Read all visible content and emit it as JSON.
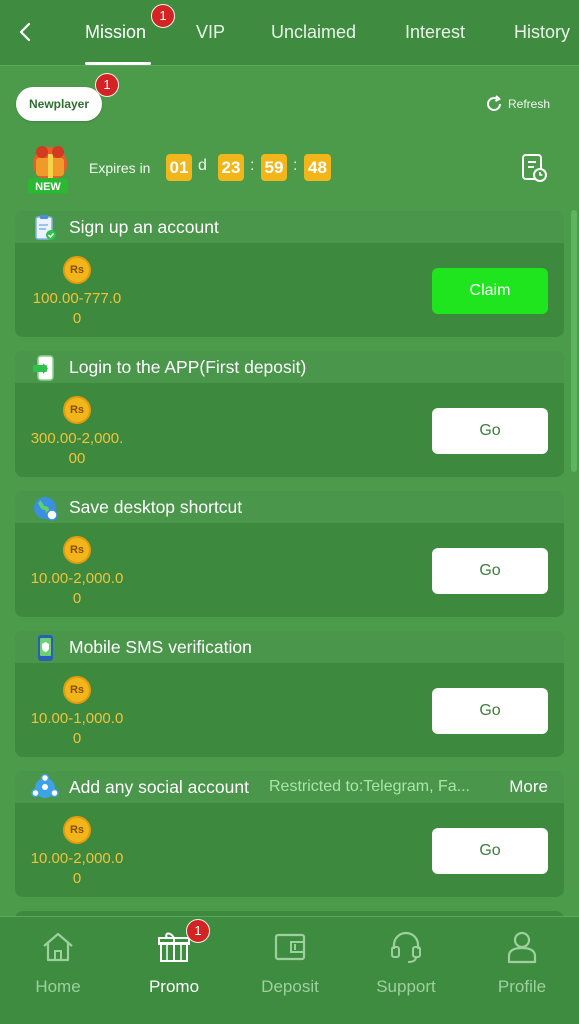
{
  "tabs": [
    {
      "label": "Mission",
      "badge": "1"
    },
    {
      "label": "VIP"
    },
    {
      "label": "Unclaimed"
    },
    {
      "label": "Interest"
    },
    {
      "label": "History"
    }
  ],
  "newplayer": {
    "label": "Newplayer",
    "badge": "1"
  },
  "refresh_label": "Refresh",
  "gift_badge": "NEW",
  "expires": {
    "label": "Expires in",
    "days": "01",
    "day_unit": "d",
    "hours": "23",
    "minutes": "59",
    "seconds": "48",
    "sep": ":"
  },
  "currency_symbol": "Rs",
  "missions": [
    {
      "title": "Sign up an account",
      "amount": "100.00-777.00",
      "button": "Claim"
    },
    {
      "title": "Login to the APP(First deposit)",
      "amount": "300.00-2,000.00",
      "button": "Go"
    },
    {
      "title": "Save desktop shortcut",
      "amount": "10.00-2,000.00",
      "button": "Go"
    },
    {
      "title": "Mobile SMS verification",
      "amount": "10.00-1,000.00",
      "button": "Go"
    },
    {
      "title": "Add any social account",
      "restricted": "Restricted to:Telegram, Fa...",
      "more": "More",
      "amount": "10.00-2,000.00",
      "button": "Go"
    }
  ],
  "nav": [
    {
      "label": "Home",
      "icon": "home-icon"
    },
    {
      "label": "Promo",
      "icon": "gift-icon",
      "badge": "1"
    },
    {
      "label": "Deposit",
      "icon": "wallet-icon"
    },
    {
      "label": "Support",
      "icon": "headset-icon"
    },
    {
      "label": "Profile",
      "icon": "user-icon"
    }
  ],
  "colors": {
    "accent": "#1ee51e",
    "timer": "#f2b51a",
    "amount": "#f2c23a",
    "badge": "#d42323"
  }
}
